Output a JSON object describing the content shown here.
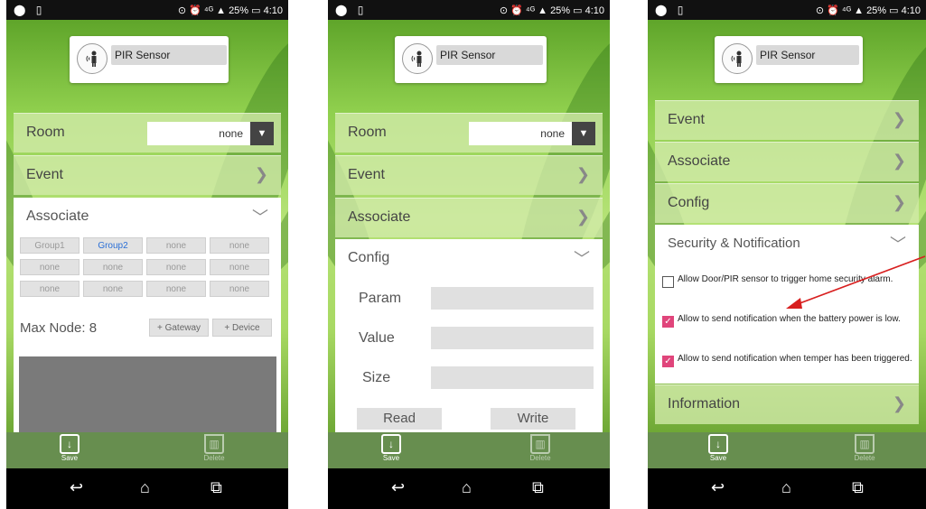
{
  "status": {
    "icons_left": "⬤ ▯",
    "icons_right": "⊙ ⏰ ⁴ᴳ ▲ 25% ▭ 4:10"
  },
  "sensor": {
    "name": "PIR Sensor",
    "icon": "person-sensor-icon"
  },
  "screens": [
    {
      "room_label": "Room",
      "room_value": "none",
      "event_label": "Event",
      "associate_label": "Associate",
      "groups": [
        "Group1",
        "Group2",
        "none",
        "none",
        "none",
        "none",
        "none",
        "none",
        "none",
        "none",
        "none",
        "none"
      ],
      "max_node_label": "Max Node: 8",
      "gateway_label": "+ Gateway",
      "device_label": "+ Device"
    },
    {
      "room_label": "Room",
      "room_value": "none",
      "event_label": "Event",
      "associate_label": "Associate",
      "config_label": "Config",
      "param_label": "Param",
      "value_label": "Value",
      "size_label": "Size",
      "read_label": "Read",
      "write_label": "Write"
    },
    {
      "event_label": "Event",
      "associate_label": "Associate",
      "config_label": "Config",
      "security_label": "Security & Notification",
      "options": [
        {
          "text": "Allow Door/PIR sensor to trigger home security alarm.",
          "checked": false
        },
        {
          "text": "Allow to send notification when the battery power is low.",
          "checked": true
        },
        {
          "text": "Allow to send notification when temper has been triggered.",
          "checked": true
        }
      ],
      "information_label": "Information"
    }
  ],
  "bottom": {
    "save_label": "Save",
    "delete_label": "Delete"
  },
  "nav": {
    "back": "↩",
    "home": "⌂",
    "recents": "⧉"
  },
  "colors": {
    "accent_pink": "#e0457b",
    "arrow_red": "#d81f1f",
    "group2_blue": "#2a6fd6"
  }
}
